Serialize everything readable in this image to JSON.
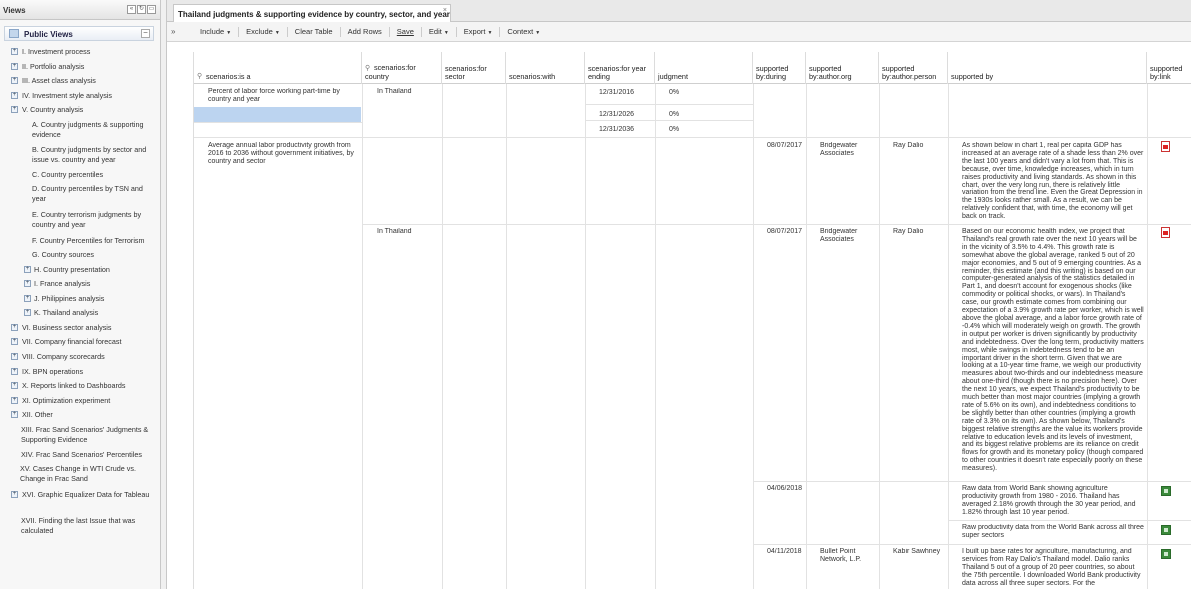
{
  "views_panel": {
    "title": "Views",
    "public_views_title": "Public Views",
    "items": [
      {
        "label": "I.  Investment process",
        "expandable": true
      },
      {
        "label": "II.  Portfolio analysis",
        "expandable": true
      },
      {
        "label": "III.  Asset class analysis",
        "expandable": true
      },
      {
        "label": "IV.  Investment style analysis",
        "expandable": true
      },
      {
        "label": "V.  Country analysis",
        "expandable": true,
        "expanded": true
      },
      {
        "label": "A. Country judgments & supporting evidence",
        "expandable": false
      },
      {
        "label": "B. Country judgments by sector and issue vs. country and year",
        "expandable": false
      },
      {
        "label": "C.  Country percentiles",
        "expandable": false
      },
      {
        "label": "D.  Country percentiles by TSN and year",
        "expandable": false
      },
      {
        "label": "E.  Country terrorism judgments by country and year",
        "expandable": false
      },
      {
        "label": "F.  Country Percentiles for Terrorism",
        "expandable": false
      },
      {
        "label": "G.  Country sources",
        "expandable": false
      },
      {
        "label": "H.  Country presentation",
        "expandable": true
      },
      {
        "label": "I.  France analysis",
        "expandable": true
      },
      {
        "label": "J.  Philippines analysis",
        "expandable": true
      },
      {
        "label": "K.  Thailand analysis",
        "expandable": true
      },
      {
        "label": "VI.  Business sector analysis",
        "expandable": true
      },
      {
        "label": "VII.  Company financial forecast",
        "expandable": true
      },
      {
        "label": "VIII.  Company scorecards",
        "expandable": true
      },
      {
        "label": "IX.  BPN operations",
        "expandable": true
      },
      {
        "label": "X.  Reports linked to Dashboards",
        "expandable": true
      },
      {
        "label": "XI.  Optimization experiment",
        "expandable": true
      },
      {
        "label": "XII.  Other",
        "expandable": true
      },
      {
        "label": "XIII.  Frac Sand Scenarios' Judgments & Supporting Evidence",
        "expandable": false
      },
      {
        "label": "XIV.  Frac Sand Scenarios' Percentiles",
        "expandable": false
      },
      {
        "label": "XV. Cases Change in WTI Crude vs. Change in Frac Sand",
        "expandable": false
      },
      {
        "label": "XVI.  Graphic Equalizer Data for Tableau",
        "expandable": true
      },
      {
        "label": "XVII.  Finding the last Issue that was calculated",
        "expandable": false
      }
    ]
  },
  "tab": {
    "title": "Thailand judgments & supporting evidence by country, sector, and year",
    "close": "×"
  },
  "toolbar": {
    "expander": "»",
    "items": [
      "Include",
      "Exclude",
      "Clear Table",
      "Add Rows",
      "Save",
      "Edit",
      "Export",
      "Context"
    ]
  },
  "grid": {
    "columns": [
      "scenarios:is a",
      "scenarios:for country",
      "scenarios:for sector",
      "scenarios:with",
      "scenarios:for year ending",
      "judgment",
      "supported by:during",
      "supported by:author.org",
      "supported by:author.person",
      "supported by",
      "supported by:link"
    ],
    "row1": {
      "is_a": "Percent of labor force working part-time by country and year",
      "country": "In Thailand",
      "years": [
        "12/31/2016",
        "12/31/2026",
        "12/31/2036"
      ],
      "judgments": [
        "0%",
        "0%",
        "0%"
      ]
    },
    "row2": {
      "is_a": "Average annual labor productivity growth from 2016 to 2036 without government initiatives, by country and sector",
      "evidence": [
        {
          "during": "08/07/2017",
          "org": "Bridgewater Associates",
          "person": "Ray Dalio",
          "text": "As shown below in chart 1, real per capita GDP has increased at an average rate of a shade less than 2% over the last 100 years and didn't vary a lot from that. This is because, over time, knowledge increases, which in turn raises productivity and living standards. As shown in this chart, over the very long run, there is relatively little variation from the trend line. Even the Great Depression in the 1930s looks rather small. As a result, we can be relatively confident that, with time, the economy will get back on track.",
          "link": "pdf"
        },
        {
          "country": "In Thailand",
          "during": "08/07/2017",
          "org": "Bridgewater Associates",
          "person": "Ray Dalio",
          "text": "Based on our economic health index, we project that Thailand's real growth rate over the next 10 years will be in the vicinity of 3.5% to 4.4%. This growth rate is somewhat above the global average, ranked 5 out of 20 major economies, and 5 out of 9 emerging countries. As a reminder, this estimate (and this writing) is based on our computer-generated analysis of the statistics detailed in Part 1, and doesn't account for exogenous shocks (like commodity or political shocks, or wars). In Thailand's case, our growth estimate comes from combining our expectation of a 3.9% growth rate per worker, which is well above the global average, and a labor force growth rate of -0.4% which will moderately weigh on growth. The growth in output per worker is driven significantly by productivity and indebtedness. Over the long term, productivity matters most, while swings in indebtedness tend to be an important driver in the short term. Given that we are looking at a 10-year time frame, we weigh our productivity measures about two-thirds and our indebtedness measure about one-third (though there is no precision here). Over the next 10 years, we expect Thailand's productivity to be much better than most major countries (implying a growth rate of 5.6% on its own), and indebtedness conditions to be slightly better than other countries (implying a growth rate of 3.3% on its own). As shown below, Thailand's biggest relative strengths are the value its workers provide relative to education levels and its levels of investment, and its biggest relative problems are its reliance on credit flows for growth and its monetary policy (though compared to other countries it doesn't rate especially poorly on these measures).",
          "link": "pdf"
        },
        {
          "during": "04/06/2018",
          "text": "Raw data from World Bank showing agriculture productivity growth from 1980 - 2016. Thailand has averaged 2.18% growth through the 30 year period, and 1.82% through last 10 year period.",
          "link": "xls"
        },
        {
          "text": "Raw productivity data from the World Bank across all three super sectors",
          "link": "xls"
        },
        {
          "during": "04/11/2018",
          "org": "Bullet Point Network, L.P.",
          "person": "Kabir Sawhney",
          "text": "I built up base rates for agriculture, manufacturing, and services from Ray Dalio's Thailand model. Dalio ranks Thailand 5 out of a group of 20 peer countries, so about the 75th percentile. I downloaded World Bank productivity data across all three super sectors. For the",
          "link": "xls"
        }
      ]
    }
  }
}
